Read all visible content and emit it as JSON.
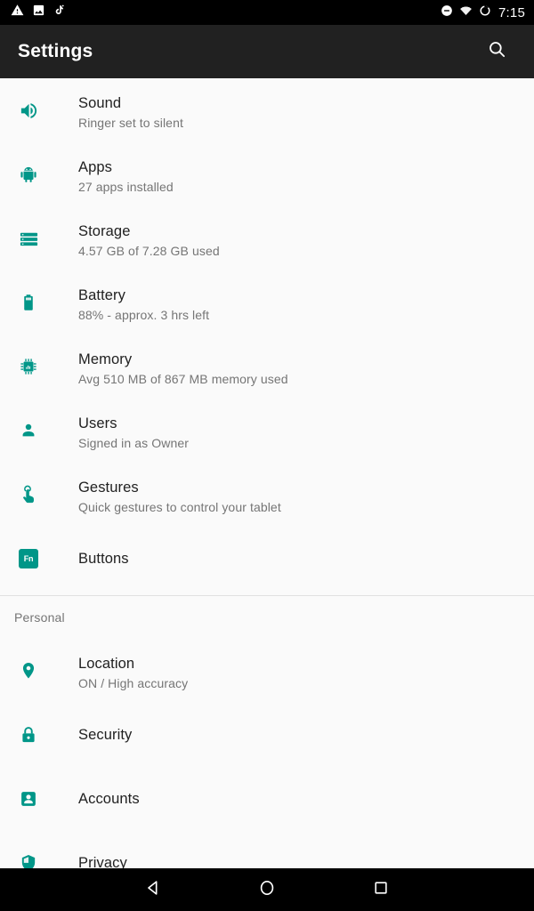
{
  "status_bar": {
    "left_icons": [
      {
        "name": "warning-icon",
        "label": "Warning"
      },
      {
        "name": "image-icon",
        "label": "Screenshot"
      },
      {
        "name": "music-note-icon",
        "label": "TikTok"
      }
    ],
    "right_icons": [
      {
        "name": "do-not-disturb-icon",
        "label": "Do not disturb"
      },
      {
        "name": "wifi-icon",
        "label": "Wi-Fi"
      },
      {
        "name": "battery-icon",
        "label": "Battery"
      }
    ],
    "clock": "7:15"
  },
  "toolbar": {
    "title": "Settings",
    "search_icon": "search-icon"
  },
  "settings": {
    "device_section": {
      "items": [
        {
          "icon": "volume-up-icon",
          "title": "Sound",
          "subtitle": "Ringer set to silent"
        },
        {
          "icon": "android-robot-icon",
          "title": "Apps",
          "subtitle": "27 apps installed"
        },
        {
          "icon": "storage-icon",
          "title": "Storage",
          "subtitle": "4.57 GB of 7.28 GB used"
        },
        {
          "icon": "battery-icon",
          "title": "Battery",
          "subtitle": "88% - approx. 3 hrs left"
        },
        {
          "icon": "memory-chip-icon",
          "title": "Memory",
          "subtitle": "Avg 510 MB of 867 MB memory used"
        },
        {
          "icon": "person-icon",
          "title": "Users",
          "subtitle": "Signed in as Owner"
        },
        {
          "icon": "gesture-tap-icon",
          "title": "Gestures",
          "subtitle": "Quick gestures to control your tablet"
        },
        {
          "icon": "fn-key-icon",
          "title": "Buttons",
          "subtitle": ""
        }
      ]
    },
    "personal_section": {
      "header": "Personal",
      "items": [
        {
          "icon": "location-pin-icon",
          "title": "Location",
          "subtitle": "ON / High accuracy"
        },
        {
          "icon": "lock-icon",
          "title": "Security",
          "subtitle": ""
        },
        {
          "icon": "account-badge-icon",
          "title": "Accounts",
          "subtitle": ""
        },
        {
          "icon": "shield-icon",
          "title": "Privacy",
          "subtitle": ""
        }
      ]
    }
  },
  "nav_bar": {
    "buttons": [
      {
        "name": "back-button",
        "label": "Back"
      },
      {
        "name": "home-button",
        "label": "Home"
      },
      {
        "name": "recents-button",
        "label": "Recents"
      }
    ]
  },
  "colors": {
    "accent": "#009688",
    "toolbar_bg": "#212121",
    "page_bg": "#fafafa",
    "title_text": "#212121",
    "subtitle_text": "#757575"
  }
}
